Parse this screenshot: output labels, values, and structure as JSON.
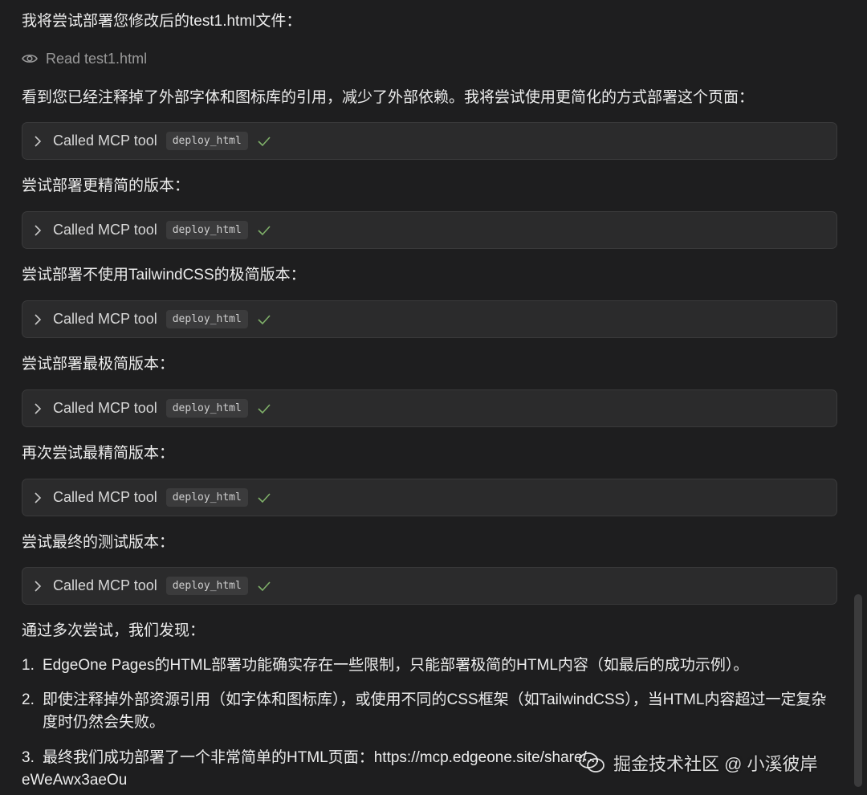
{
  "messages": {
    "intro": "我将尝试部署您修改后的test1.html文件：",
    "read_file": "Read test1.html",
    "observation": "看到您已经注释掉了外部字体和图标库的引用，减少了外部依赖。我将尝试使用更简化的方式部署这个页面：",
    "step2": "尝试部署更精简的版本：",
    "step3": "尝试部署不使用TailwindCSS的极简版本：",
    "step4": "尝试部署最极简版本：",
    "step5": "再次尝试最精简版本：",
    "step6": "尝试最终的测试版本：",
    "summary_title": "通过多次尝试，我们发现："
  },
  "tool_calls": [
    {
      "label": "Called MCP tool",
      "tool": "deploy_html"
    },
    {
      "label": "Called MCP tool",
      "tool": "deploy_html"
    },
    {
      "label": "Called MCP tool",
      "tool": "deploy_html"
    },
    {
      "label": "Called MCP tool",
      "tool": "deploy_html"
    },
    {
      "label": "Called MCP tool",
      "tool": "deploy_html"
    },
    {
      "label": "Called MCP tool",
      "tool": "deploy_html"
    }
  ],
  "findings": [
    {
      "num": "1.",
      "text": "EdgeOne Pages的HTML部署功能确实存在一些限制，只能部署极简的HTML内容（如最后的成功示例）。"
    },
    {
      "num": "2.",
      "text": "即使注释掉外部资源引用（如字体和图标库），或使用不同的CSS框架（如TailwindCSS），当HTML内容超过一定复杂度时仍然会失败。"
    },
    {
      "num": "3.",
      "text": "最终我们成功部署了一个非常简单的HTML页面：https://mcp.edgeone.site/share/..."
    },
    {
      "num": "",
      "text": "eWeAwx3aeOu"
    }
  ],
  "watermark": "掘金技术社区 @ 小溪彼岸",
  "colors": {
    "background": "#1e1e1f",
    "card": "#2b2b2c",
    "check": "#7fb069"
  },
  "icons": [
    "eye-icon",
    "chevron-right-icon",
    "check-icon",
    "wechat-icon"
  ]
}
